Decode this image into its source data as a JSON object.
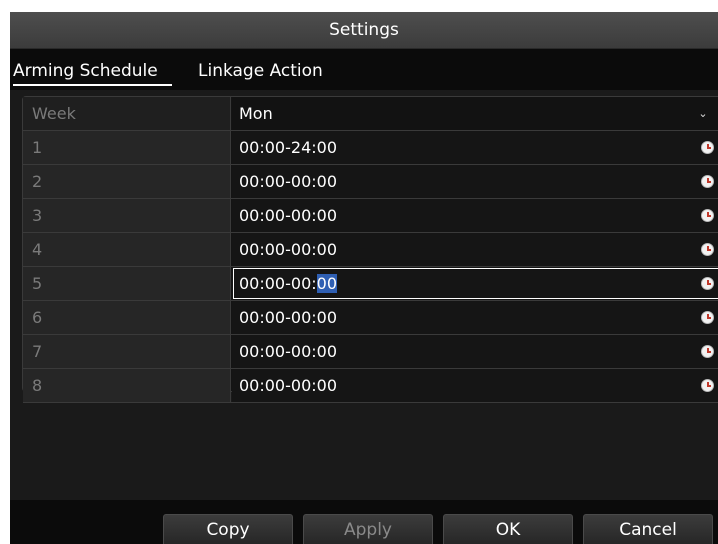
{
  "window": {
    "title": "Settings"
  },
  "tabs": [
    {
      "label": "Arming Schedule",
      "active": true
    },
    {
      "label": "Linkage Action",
      "active": false
    }
  ],
  "schedule": {
    "week_label": "Week",
    "week_value": "Mon",
    "rows": [
      {
        "index": "1",
        "time": "00:00-24:00"
      },
      {
        "index": "2",
        "time": "00:00-00:00"
      },
      {
        "index": "3",
        "time": "00:00-00:00"
      },
      {
        "index": "4",
        "time": "00:00-00:00"
      },
      {
        "index": "5",
        "time_prefix": "00:00-00:",
        "time_selected": "00",
        "selected": true
      },
      {
        "index": "6",
        "time": "00:00-00:00"
      },
      {
        "index": "7",
        "time": "00:00-00:00"
      },
      {
        "index": "8",
        "time": "00:00-00:00"
      }
    ]
  },
  "buttons": {
    "copy": "Copy",
    "apply": "Apply",
    "ok": "OK",
    "cancel": "Cancel"
  },
  "icons": {
    "dropdown": "chevron-down-icon",
    "time_picker": "clock-icon"
  }
}
